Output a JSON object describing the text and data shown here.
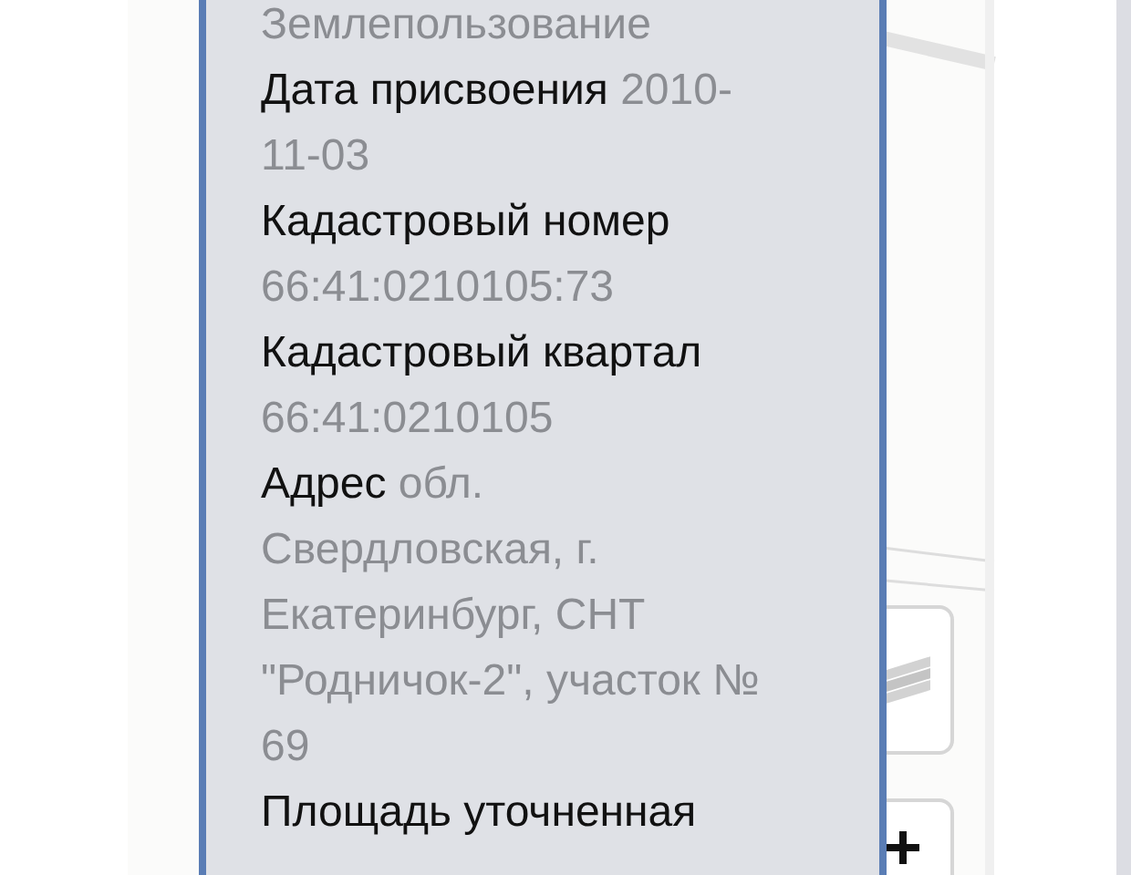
{
  "info_panel": {
    "fields": [
      {
        "value": "Землепользование"
      },
      {
        "label": "Дата присвоения",
        "value": "2010-11-03"
      },
      {
        "label": "Кадастровый номер",
        "value": "66:41:0210105:73"
      },
      {
        "label": "Кадастровый квартал",
        "value": "66:41:0210105"
      },
      {
        "label": "Адрес",
        "value": "обл. Свердловская, г. Екатеринбург, СНТ \"Родничок-2\", участок № 69"
      },
      {
        "label": "Площадь уточненная"
      }
    ]
  }
}
